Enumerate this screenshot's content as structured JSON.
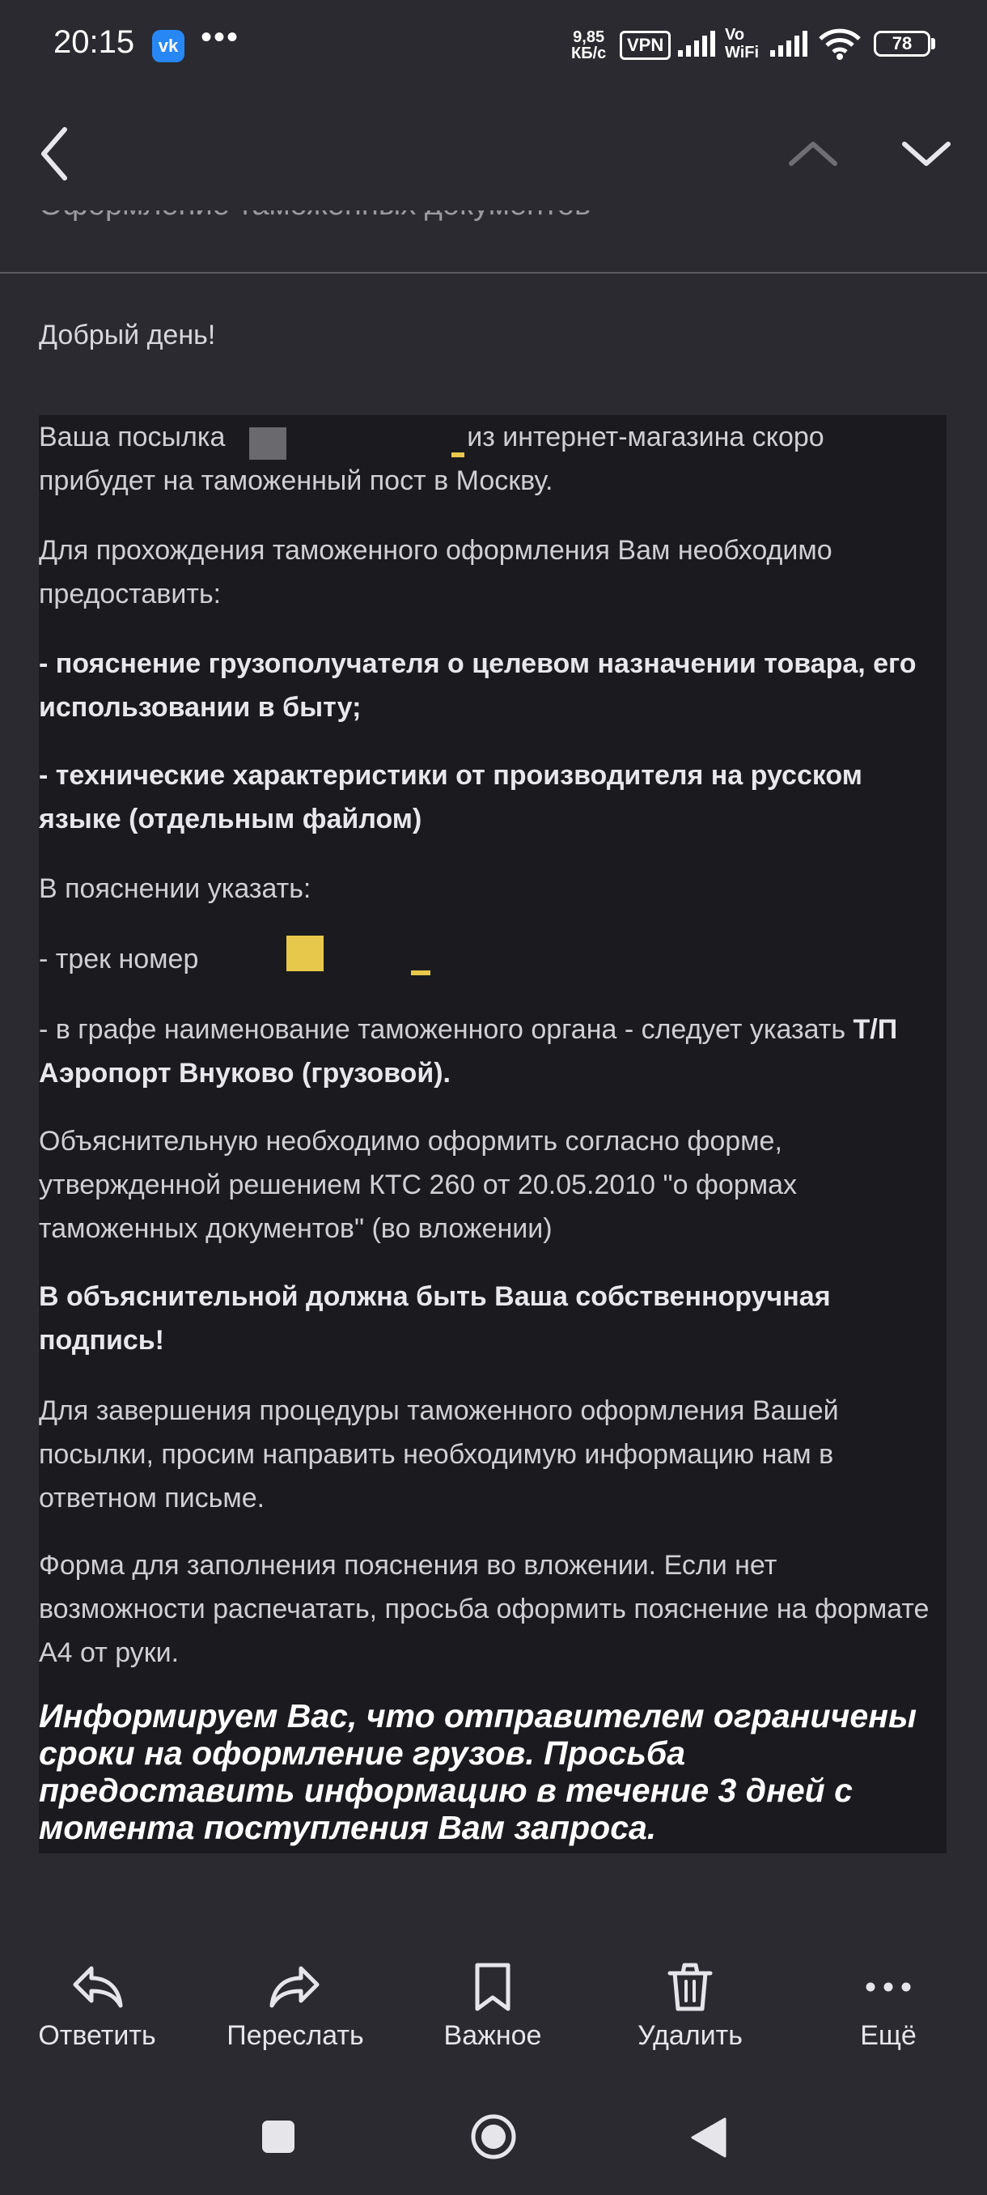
{
  "status_bar": {
    "time": "20:15",
    "vk_badge": "vk",
    "dots": "•••",
    "net_speed_value": "9,85",
    "net_speed_unit": "КБ/с",
    "vpn": "VPN",
    "vowifi_top": "Vo",
    "vowifi_bottom": "WiFi",
    "battery_level": "78"
  },
  "toolbar": {
    "icons": [
      "back-icon",
      "chevron-up-icon",
      "chevron-down-icon"
    ],
    "subject_partial": "Оформление таможенных документов"
  },
  "email": {
    "greeting": "Добрый день!",
    "p1_a": "Ваша посылка",
    "p1_b": "из интернет-магазина скоро прибудет на таможенный пост в Москву.",
    "p2": "Для прохождения таможенного оформления Вам необходимо предоставить:",
    "p3": "- пояснение грузополучателя о целевом назначении товара, его использовании в быту;",
    "p4": "- технические характеристики от производителя на русском языке (отдельным файлом)",
    "p5": "В пояснении указать:",
    "p6": "- трек номер",
    "p7_a": "- в графе наименование таможенного органа - следует указать",
    "p7_b": "Т/П Аэропорт Внуково (грузовой).",
    "p8": "Объяснительную необходимо оформить согласно форме, утвержденной решением КТС 260 от 20.05.2010 \"о формах таможенных документов\" (во вложении)",
    "p9": "В объяснительной должна быть Ваша собственноручная подпись!",
    "p10": "Для завершения процедуры таможенного оформления Вашей посылки, просим направить необходимую информацию нам в ответном письме.",
    "p11": "Форма для заполнения пояснения во вложении. Если нет возможности распечатать, просьба оформить пояснение на формате А4 от руки.",
    "warning": "Информируем Вас, что отправителем ограничены сроки на оформление грузов. Просьба предоставить информацию в течение 3 дней с момента поступления Вам запроса."
  },
  "actions": {
    "reply": "Ответить",
    "forward": "Переслать",
    "important": "Важное",
    "delete": "Удалить",
    "more": "Ещё"
  },
  "colors": {
    "background": "#2a2a30",
    "message_background": "#1b1b1f",
    "vk_brand": "#2787f5",
    "redaction_yellow": "#e8c84a"
  }
}
